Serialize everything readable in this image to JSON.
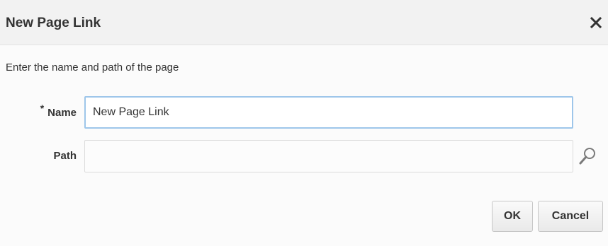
{
  "dialog": {
    "title": "New Page Link",
    "close_icon": "close-icon",
    "close_glyph": "✕"
  },
  "form": {
    "instruction": "Enter the name and path of the page",
    "name": {
      "required_marker": "*",
      "label": "Name",
      "value": "New Page Link",
      "placeholder": ""
    },
    "path": {
      "label": "Path",
      "value": "",
      "placeholder": "",
      "search_icon": "search-icon"
    }
  },
  "buttons": {
    "ok_label": "OK",
    "cancel_label": "Cancel"
  },
  "colors": {
    "focus_border": "#9ec6ea",
    "text": "#333333",
    "header_bg": "#f2f2f2"
  }
}
